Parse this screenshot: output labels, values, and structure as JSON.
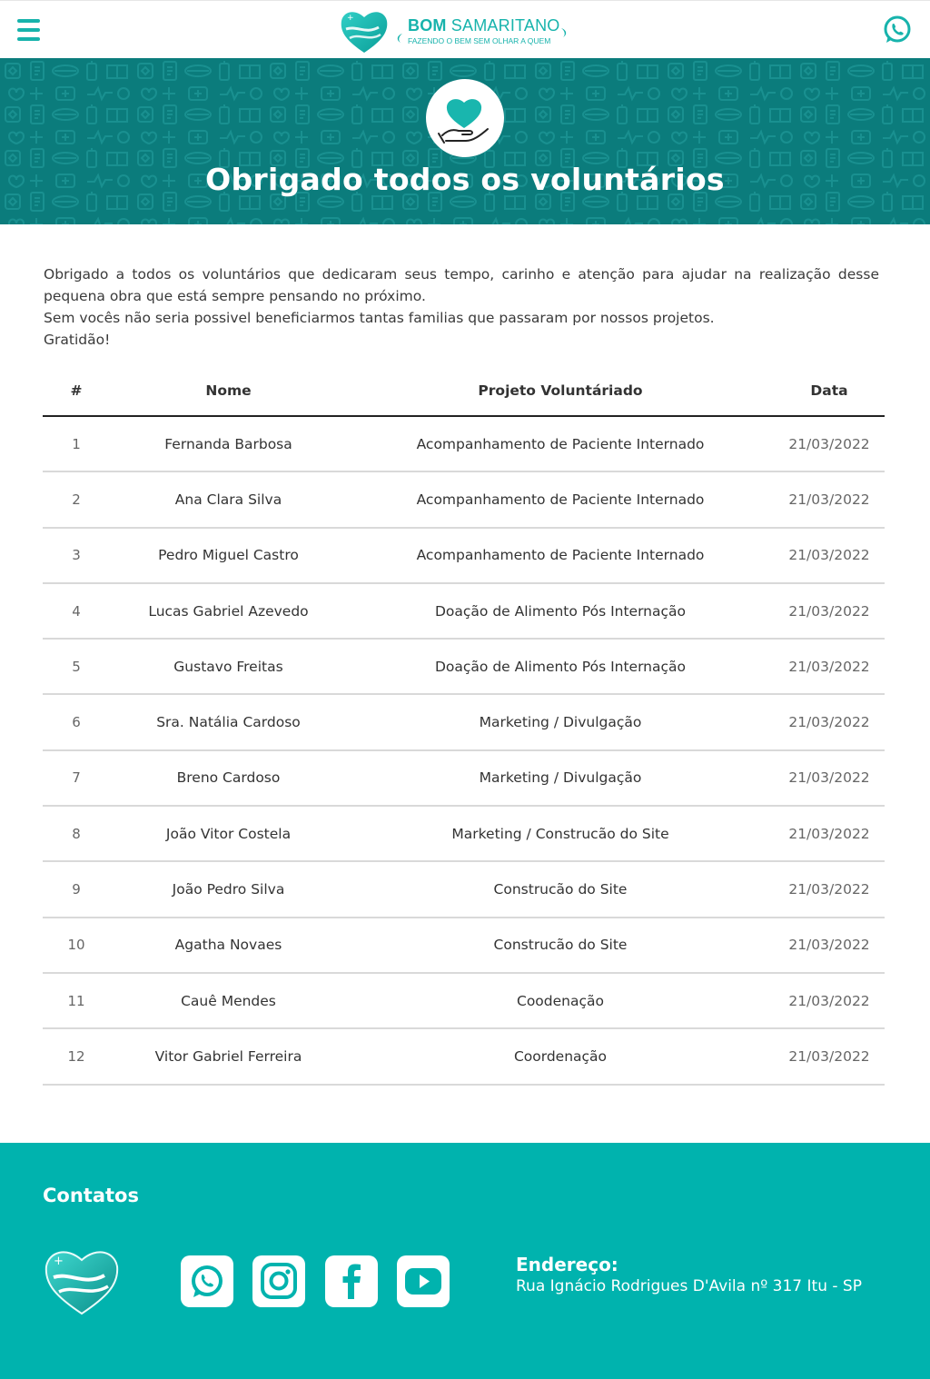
{
  "header": {
    "menu_icon": "hamburger-menu-icon",
    "logo": {
      "title_bold": "BOM",
      "title_rest": " SAMARITANO",
      "tagline": "FAZENDO O BEM SEM OLHAR A QUEM"
    },
    "whatsapp_icon": "whatsapp-icon",
    "accent_color": "#17b3ac"
  },
  "banner": {
    "title": "Obrigado todos os voluntários",
    "icon": "heart-in-hand-icon",
    "background_color": "#0b7c7c"
  },
  "intro": {
    "paragraph_1": "Obrigado a todos os voluntários que dedicaram seus tempo, carinho e atenção para ajudar na realização desse pequena obra que está sempre pensando no próximo.",
    "paragraph_2": "Sem vocês não seria possivel beneficiarmos tantas familias que passaram por nossos projetos.",
    "paragraph_3": "Gratidão!"
  },
  "table": {
    "headers": [
      "#",
      "Nome",
      "Projeto Voluntáriado",
      "Data"
    ],
    "rows": [
      {
        "num": "1",
        "name": "Fernanda Barbosa",
        "project": "Acompanhamento de Paciente Internado",
        "date": "21/03/2022"
      },
      {
        "num": "2",
        "name": "Ana Clara Silva",
        "project": "Acompanhamento de Paciente Internado",
        "date": "21/03/2022"
      },
      {
        "num": "3",
        "name": "Pedro Miguel Castro",
        "project": "Acompanhamento de Paciente Internado",
        "date": "21/03/2022"
      },
      {
        "num": "4",
        "name": "Lucas Gabriel Azevedo",
        "project": "Doação de Alimento Pós Internação",
        "date": "21/03/2022"
      },
      {
        "num": "5",
        "name": "Gustavo Freitas",
        "project": "Doação de Alimento Pós Internação",
        "date": "21/03/2022"
      },
      {
        "num": "6",
        "name": "Sra. Natália Cardoso",
        "project": "Marketing / Divulgação",
        "date": "21/03/2022"
      },
      {
        "num": "7",
        "name": "Breno Cardoso",
        "project": "Marketing / Divulgação",
        "date": "21/03/2022"
      },
      {
        "num": "8",
        "name": "João Vitor Costela",
        "project": "Marketing / Construcão do Site",
        "date": "21/03/2022"
      },
      {
        "num": "9",
        "name": "João Pedro Silva",
        "project": "Construcão do Site",
        "date": "21/03/2022"
      },
      {
        "num": "10",
        "name": "Agatha Novaes",
        "project": "Construcão do Site",
        "date": "21/03/2022"
      },
      {
        "num": "11",
        "name": "Cauê Mendes",
        "project": "Coodenação",
        "date": "21/03/2022"
      },
      {
        "num": "12",
        "name": "Vitor Gabriel Ferreira",
        "project": "Coordenação",
        "date": "21/03/2022"
      }
    ]
  },
  "footer": {
    "title": "Contatos",
    "logo_icon": "heart-logo-icon",
    "social_icons": [
      "whatsapp-icon",
      "instagram-icon",
      "facebook-icon",
      "youtube-icon"
    ],
    "address_label": "Endereço:",
    "address_value": "Rua Ignácio Rodrigues D'Avila nº 317 Itu - SP",
    "background_color": "#00b3ae"
  }
}
